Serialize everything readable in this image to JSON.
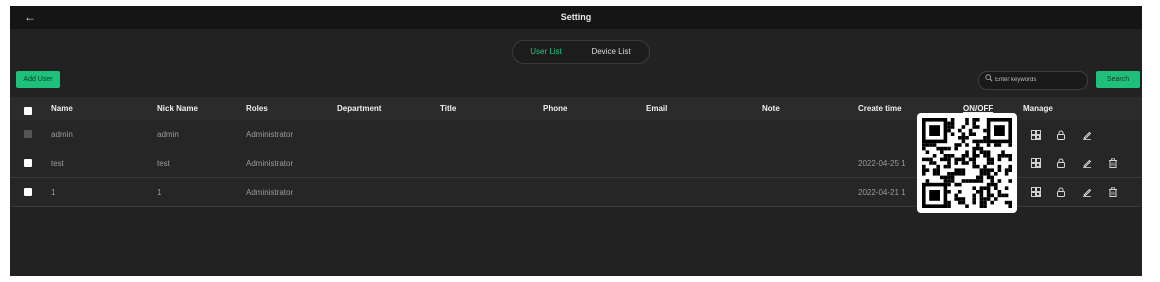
{
  "window": {
    "title": "Setting",
    "back_icon": "arrow-left-icon"
  },
  "tabs": [
    {
      "label": "User List",
      "active": true
    },
    {
      "label": "Device List",
      "active": false
    }
  ],
  "toolbar": {
    "add_label": "Add User",
    "search_placeholder": "Enter keywords",
    "search_label": "Search",
    "search_icon": "search-icon"
  },
  "colors": {
    "accent": "#1ec07a",
    "accent_text": "#27c77f",
    "background": "#222222",
    "titlebar": "#151515"
  },
  "table": {
    "columns": [
      "Name",
      "Nick Name",
      "Roles",
      "Department",
      "Title",
      "Phone",
      "Email",
      "Note",
      "Create time",
      "ON/OFF",
      "Manage"
    ],
    "rows": [
      {
        "name": "admin",
        "nick_name": "admin",
        "roles": "Administrator",
        "create_time": "",
        "checkbox_disabled": true
      },
      {
        "name": "test",
        "nick_name": "test",
        "roles": "Administrator",
        "create_time": "2022-04-25 1",
        "checkbox_disabled": false
      },
      {
        "name": "1",
        "nick_name": "1",
        "roles": "Administrator",
        "create_time": "2022-04-21 1",
        "checkbox_disabled": false
      }
    ],
    "manage_icons": [
      "qr-code-icon",
      "lock-icon",
      "edit-icon",
      "delete-icon"
    ]
  },
  "overlay": {
    "type": "qr-code-popup"
  }
}
